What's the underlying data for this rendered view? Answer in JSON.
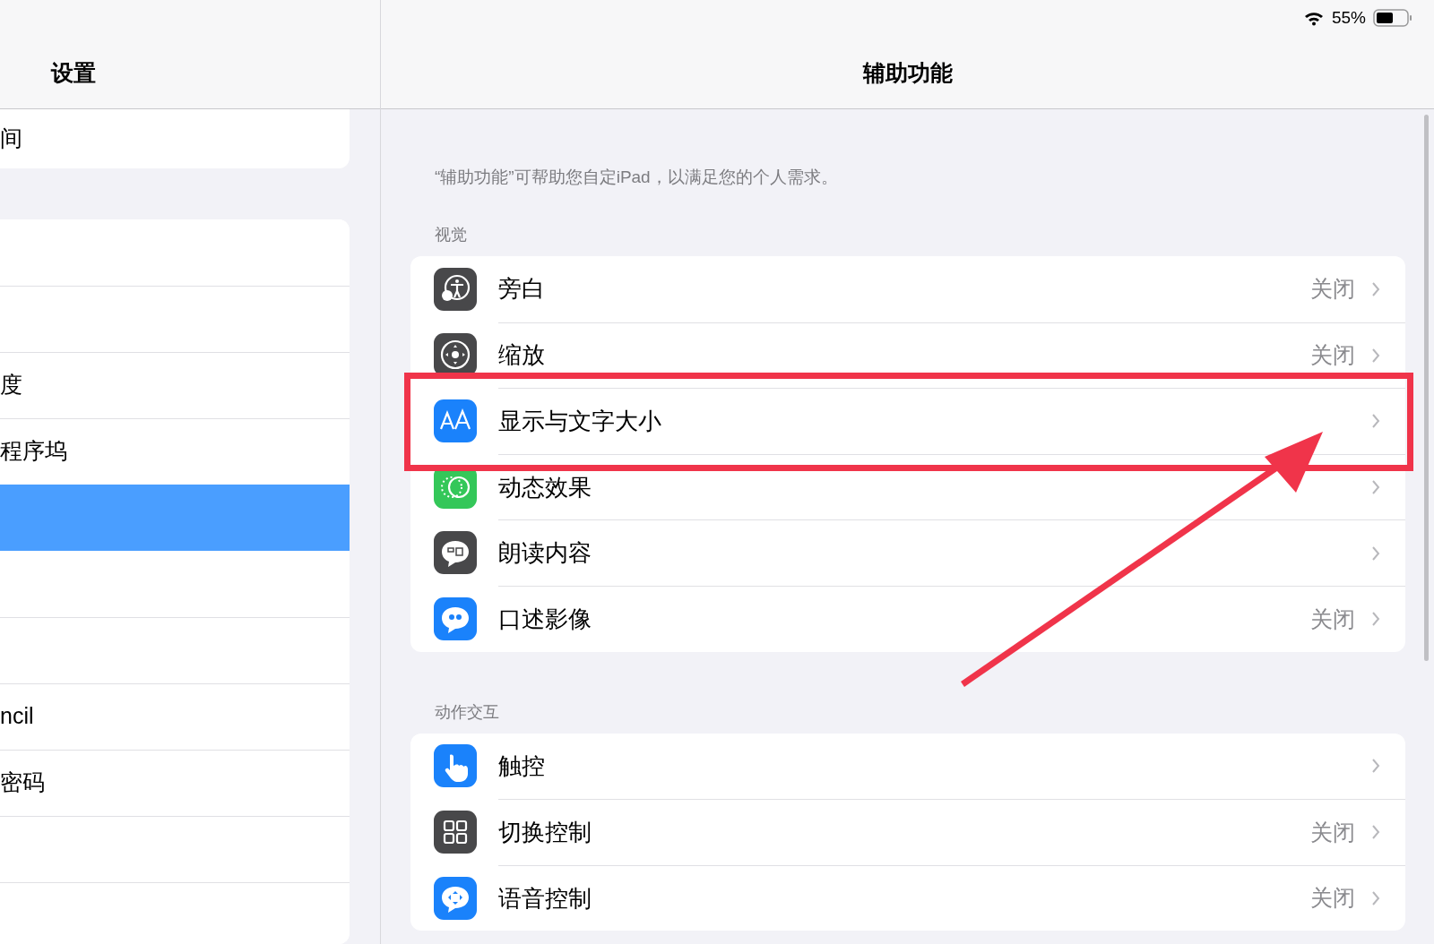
{
  "status_bar": {
    "battery": "55%"
  },
  "sidebar": {
    "title": "设置",
    "groups": [
      {
        "items": [
          {
            "label": "间",
            "selected": false
          }
        ]
      },
      {
        "items": [
          {
            "selected": false
          },
          {
            "selected": false
          },
          {
            "label": "度",
            "selected": false
          },
          {
            "label": "程序坞",
            "selected": false
          },
          {
            "selected": true
          },
          {
            "selected": false
          },
          {
            "selected": false
          },
          {
            "label": "ncil",
            "selected": false
          },
          {
            "label": "密码",
            "selected": false
          },
          {
            "selected": false
          },
          {
            "selected": false
          }
        ]
      }
    ]
  },
  "detail": {
    "title": "辅助功能",
    "description": "“辅助功能”可帮助您自定iPad，以满足您的个人需求。",
    "sections": [
      {
        "header": "视觉",
        "rows": [
          {
            "kind": "voiceover",
            "label": "旁白",
            "value": "关闭"
          },
          {
            "kind": "zoom",
            "label": "缩放",
            "value": "关闭"
          },
          {
            "kind": "text-size",
            "label": "显示与文字大小"
          },
          {
            "kind": "motion",
            "label": "动态效果"
          },
          {
            "kind": "spoken",
            "label": "朗读内容"
          },
          {
            "kind": "audio-description",
            "label": "口述影像",
            "value": "关闭"
          }
        ]
      },
      {
        "header": "动作交互",
        "rows": [
          {
            "kind": "touch",
            "label": "触控"
          },
          {
            "kind": "switch",
            "label": "切换控制",
            "value": "关闭"
          },
          {
            "kind": "voice",
            "label": "语音控制",
            "value": "关闭"
          }
        ]
      }
    ]
  }
}
